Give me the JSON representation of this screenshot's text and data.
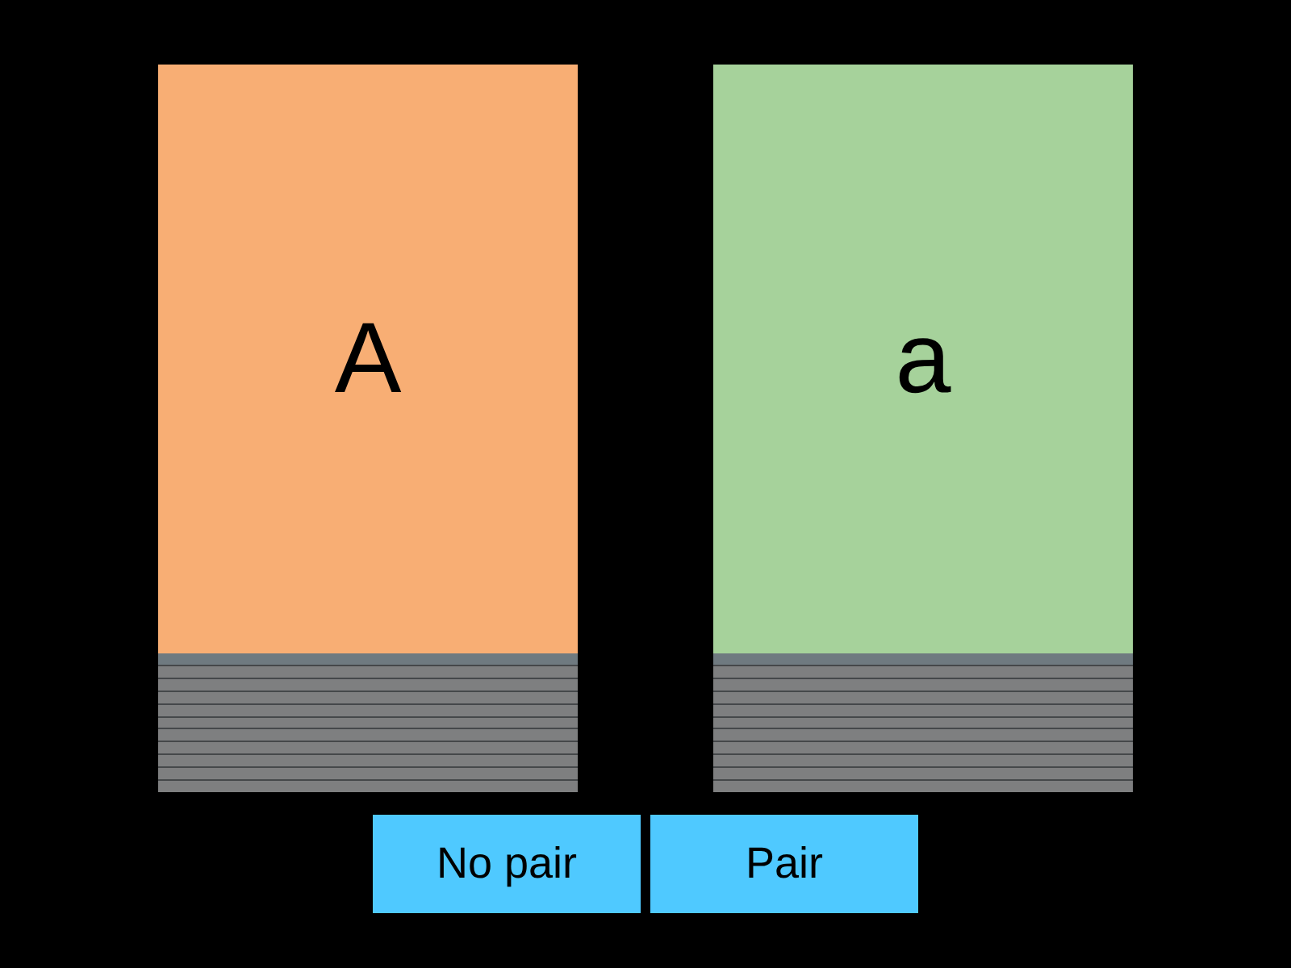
{
  "cards": [
    {
      "label": "A",
      "color": "#f8ae74"
    },
    {
      "label": "a",
      "color": "#a6d29b"
    }
  ],
  "buttons": [
    {
      "label": "No pair"
    },
    {
      "label": "Pair"
    }
  ]
}
